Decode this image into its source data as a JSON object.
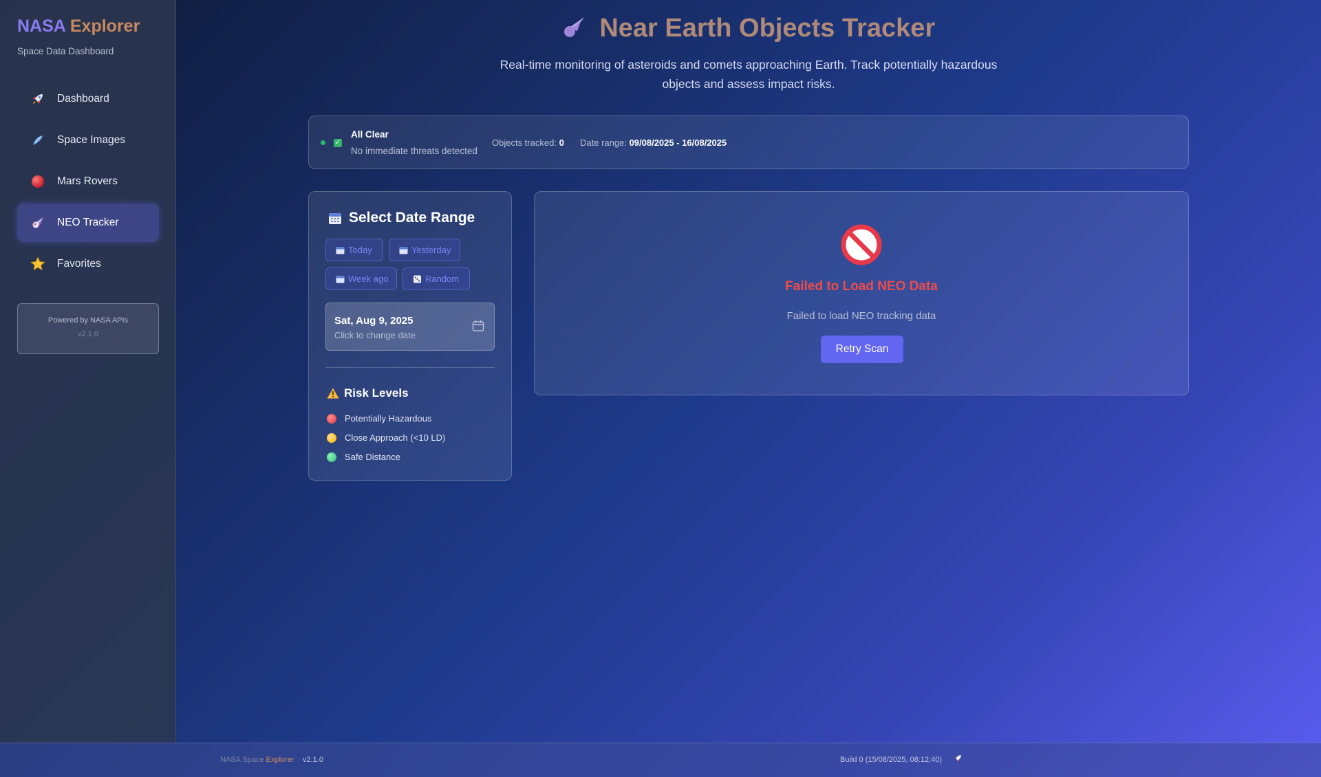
{
  "sidebar": {
    "brand_part1": "NASA",
    "brand_part2": "Explorer",
    "subtitle": "Space Data Dashboard",
    "items": [
      {
        "label": "Dashboard",
        "icon": "rocket-icon"
      },
      {
        "label": "Space Images",
        "icon": "telescope-icon"
      },
      {
        "label": "Mars Rovers",
        "icon": "red-planet-icon"
      },
      {
        "label": "NEO Tracker",
        "icon": "comet-icon",
        "active": true
      },
      {
        "label": "Favorites",
        "icon": "star-icon"
      }
    ],
    "powered_by": "Powered by NASA APIs",
    "version": "v2.1.0"
  },
  "header": {
    "title": "Near Earth Objects Tracker",
    "description": "Real-time monitoring of asteroids and comets approaching Earth. Track potentially hazardous objects and assess impact risks."
  },
  "status": {
    "title": "All Clear",
    "description": "No immediate threats detected",
    "objects_label": "Objects tracked:",
    "objects_value": "0",
    "range_label": "Date range:",
    "range_value": "09/08/2025 - 16/08/2025"
  },
  "date_panel": {
    "title": "Select Date Range",
    "quick_buttons": [
      "Today",
      "Yesterday",
      "Week ago",
      "Random"
    ],
    "selected_date": "Sat, Aug 9, 2025",
    "hint": "Click to change date",
    "risk_title": "Risk Levels",
    "risk_levels": [
      {
        "label": "Potentially Hazardous",
        "color": "#e63946"
      },
      {
        "label": "Close Approach (<10 LD)",
        "color": "#f4b400"
      },
      {
        "label": "Safe Distance",
        "color": "#2ec27e"
      }
    ]
  },
  "error_panel": {
    "title": "Failed to Load NEO Data",
    "message": "Failed to load NEO tracking data",
    "retry_label": "Retry Scan"
  },
  "footer": {
    "brand_prefix": "NASA Space",
    "brand_accent": "Explorer",
    "version": "v2.1.0",
    "build": "Build 0 (15/08/2025, 08:12:40)"
  },
  "colors": {
    "accent": "#6366f1",
    "error": "#ef4a4a",
    "success": "#2bb673"
  }
}
